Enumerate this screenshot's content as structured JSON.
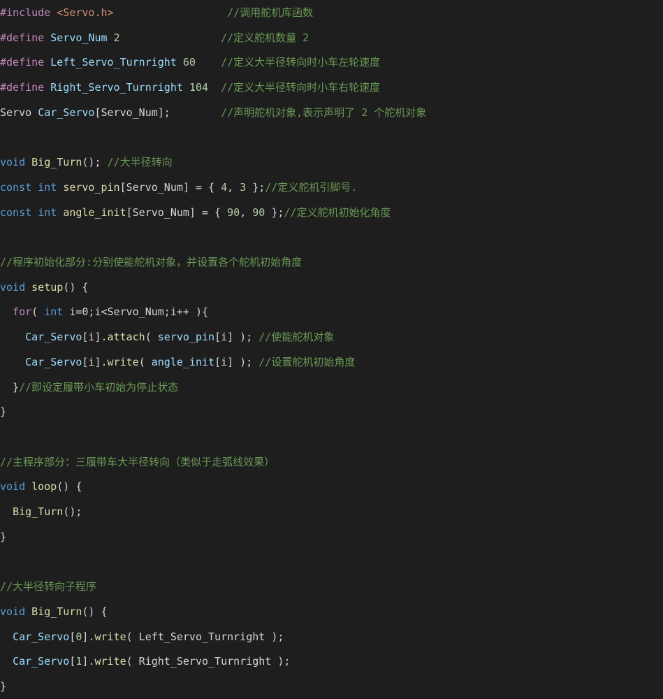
{
  "editor": {
    "colors": {
      "background": "#1e1e1e",
      "preprocessor": "#c586c0",
      "keyword": "#569cd6",
      "control": "#c586c0",
      "function": "#dcdcaa",
      "variable": "#9cdcfe",
      "type": "#4ec9b0",
      "number": "#b5cea8",
      "string": "#ce9178",
      "comment": "#6a9955",
      "plain": "#d4d4d4"
    },
    "lines": [
      [
        [
          "pre",
          "#include"
        ],
        [
          "pln",
          " "
        ],
        [
          "str",
          "<Servo.h>"
        ],
        [
          "pln",
          "                  "
        ],
        [
          "cmt",
          "//调用舵机库函数"
        ]
      ],
      [
        [
          "pre",
          "#define"
        ],
        [
          "pln",
          " "
        ],
        [
          "var",
          "Servo_Num"
        ],
        [
          "pln",
          " "
        ],
        [
          "num",
          "2"
        ],
        [
          "pln",
          "                "
        ],
        [
          "cmt",
          "//定义舵机数量 2"
        ]
      ],
      [
        [
          "pre",
          "#define"
        ],
        [
          "pln",
          " "
        ],
        [
          "var",
          "Left_Servo_Turnright"
        ],
        [
          "pln",
          " "
        ],
        [
          "num",
          "60"
        ],
        [
          "pln",
          "    "
        ],
        [
          "cmt",
          "//定义大半径转向时小车左轮速度"
        ]
      ],
      [
        [
          "pre",
          "#define"
        ],
        [
          "pln",
          " "
        ],
        [
          "var",
          "Right_Servo_Turnright"
        ],
        [
          "pln",
          " "
        ],
        [
          "num",
          "104"
        ],
        [
          "pln",
          "  "
        ],
        [
          "cmt",
          "//定义大半径转向时小车右轮速度"
        ]
      ],
      [
        [
          "pln",
          "Servo "
        ],
        [
          "var",
          "Car_Servo"
        ],
        [
          "pln",
          "[Servo_Num];        "
        ],
        [
          "cmt",
          "//声明舵机对象,表示声明了 2 个舵机对象"
        ]
      ],
      [],
      [
        [
          "kw",
          "void"
        ],
        [
          "pln",
          " "
        ],
        [
          "fn",
          "Big_Turn"
        ],
        [
          "pln",
          "(); "
        ],
        [
          "cmt",
          "//大半径转向"
        ]
      ],
      [
        [
          "kw",
          "const"
        ],
        [
          "pln",
          " "
        ],
        [
          "kw",
          "int"
        ],
        [
          "pln",
          " "
        ],
        [
          "fn",
          "servo_pin"
        ],
        [
          "pln",
          "[Servo_Num] = { "
        ],
        [
          "num",
          "4"
        ],
        [
          "pln",
          ", "
        ],
        [
          "num",
          "3"
        ],
        [
          "pln",
          " };"
        ],
        [
          "cmt",
          "//定义舵机引脚号."
        ]
      ],
      [
        [
          "kw",
          "const"
        ],
        [
          "pln",
          " "
        ],
        [
          "kw",
          "int"
        ],
        [
          "pln",
          " "
        ],
        [
          "fn",
          "angle_init"
        ],
        [
          "pln",
          "[Servo_Num] = { "
        ],
        [
          "num",
          "90"
        ],
        [
          "pln",
          ", "
        ],
        [
          "num",
          "90"
        ],
        [
          "pln",
          " };"
        ],
        [
          "cmt",
          "//定义舵机初始化角度"
        ]
      ],
      [],
      [
        [
          "cmt",
          "//程序初始化部分:分别使能舵机对象，并设置各个舵机初始角度"
        ]
      ],
      [
        [
          "kw",
          "void"
        ],
        [
          "pln",
          " "
        ],
        [
          "fn",
          "setup"
        ],
        [
          "pln",
          "() {"
        ]
      ],
      [
        [
          "pln",
          "  "
        ],
        [
          "ctl",
          "for"
        ],
        [
          "pln",
          "( "
        ],
        [
          "kw",
          "int"
        ],
        [
          "pln",
          " i=0;i<Servo_Num;i++ ){"
        ]
      ],
      [
        [
          "pln",
          "    "
        ],
        [
          "var",
          "Car_Servo"
        ],
        [
          "pln",
          "[i]."
        ],
        [
          "fn",
          "attach"
        ],
        [
          "pln",
          "( "
        ],
        [
          "var",
          "servo_pin"
        ],
        [
          "pln",
          "[i] ); "
        ],
        [
          "cmt",
          "//使能舵机对象"
        ]
      ],
      [
        [
          "pln",
          "    "
        ],
        [
          "var",
          "Car_Servo"
        ],
        [
          "pln",
          "[i]."
        ],
        [
          "fn",
          "write"
        ],
        [
          "pln",
          "( "
        ],
        [
          "var",
          "angle_init"
        ],
        [
          "pln",
          "[i] ); "
        ],
        [
          "cmt",
          "//设置舵机初始角度"
        ]
      ],
      [
        [
          "pln",
          "  }"
        ],
        [
          "cmt",
          "//即设定履带小车初始为停止状态"
        ]
      ],
      [
        [
          "pln",
          "}"
        ]
      ],
      [],
      [
        [
          "cmt",
          "//主程序部分：三履带车大半径转向（类似于走弧线效果）"
        ]
      ],
      [
        [
          "kw",
          "void"
        ],
        [
          "pln",
          " "
        ],
        [
          "fn",
          "loop"
        ],
        [
          "pln",
          "() {"
        ]
      ],
      [
        [
          "pln",
          "  "
        ],
        [
          "fn",
          "Big_Turn"
        ],
        [
          "pln",
          "();"
        ]
      ],
      [
        [
          "pln",
          "}"
        ]
      ],
      [],
      [
        [
          "cmt",
          "//大半径转向子程序"
        ]
      ],
      [
        [
          "kw",
          "void"
        ],
        [
          "pln",
          " "
        ],
        [
          "fn",
          "Big_Turn"
        ],
        [
          "pln",
          "() {"
        ]
      ],
      [
        [
          "pln",
          "  "
        ],
        [
          "var",
          "Car_Servo"
        ],
        [
          "pln",
          "["
        ],
        [
          "num",
          "0"
        ],
        [
          "pln",
          "]."
        ],
        [
          "fn",
          "write"
        ],
        [
          "pln",
          "( Left_Servo_Turnright );"
        ]
      ],
      [
        [
          "pln",
          "  "
        ],
        [
          "var",
          "Car_Servo"
        ],
        [
          "pln",
          "["
        ],
        [
          "num",
          "1"
        ],
        [
          "pln",
          "]."
        ],
        [
          "fn",
          "write"
        ],
        [
          "pln",
          "( Right_Servo_Turnright );"
        ]
      ],
      [
        [
          "pln",
          "}"
        ]
      ]
    ]
  }
}
